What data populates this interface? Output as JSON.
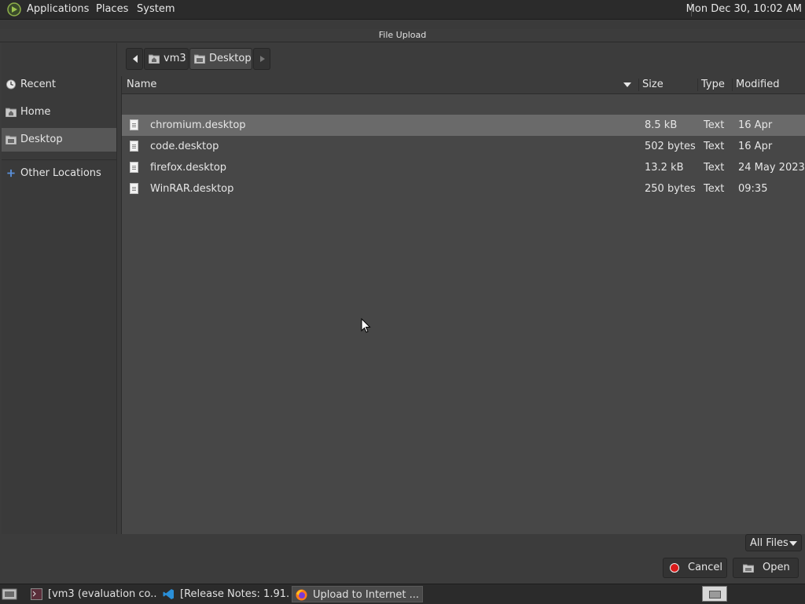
{
  "top_panel": {
    "menus": [
      "Applications",
      "Places",
      "System"
    ],
    "clock": "Mon Dec 30, 10:02 AM"
  },
  "dialog": {
    "title": "File Upload",
    "sidebar": {
      "items": [
        {
          "label": "Recent",
          "icon": "recent-icon"
        },
        {
          "label": "Home",
          "icon": "home-folder-icon"
        },
        {
          "label": "Desktop",
          "icon": "desktop-folder-icon",
          "selected": true
        },
        {
          "label": "Other Locations",
          "icon": "plus-icon"
        }
      ]
    },
    "pathbar": {
      "segments": [
        "vm3",
        "Desktop"
      ]
    },
    "filelist": {
      "columns": [
        "Name",
        "Size",
        "Type",
        "Modified"
      ],
      "rows": [
        {
          "name": "chromium.desktop",
          "size": "8.5 kB",
          "type": "Text",
          "modified": "16 Apr",
          "selected": true
        },
        {
          "name": "code.desktop",
          "size": "502 bytes",
          "type": "Text",
          "modified": "16 Apr"
        },
        {
          "name": "firefox.desktop",
          "size": "13.2 kB",
          "type": "Text",
          "modified": "24 May 2023"
        },
        {
          "name": "WinRAR.desktop",
          "size": "250 bytes",
          "type": "Text",
          "modified": "09:35"
        }
      ]
    },
    "filter": "All Files",
    "buttons": {
      "cancel": "Cancel",
      "open": "Open"
    }
  },
  "taskbar": {
    "tasks": [
      {
        "label": "[vm3 (evaluation co...",
        "icon": "terminal-icon"
      },
      {
        "label": "[Release Notes: 1.91...",
        "icon": "vscode-icon"
      },
      {
        "label": "Upload to Internet ...",
        "icon": "firefox-icon",
        "active": true
      }
    ]
  },
  "colors": {
    "panel_bg": "#2b2b2b",
    "dialog_bg": "#3c3c3c",
    "list_bg": "#474747",
    "selected_row": "#6a6a6a",
    "cancel_red": "#d81a1a"
  }
}
